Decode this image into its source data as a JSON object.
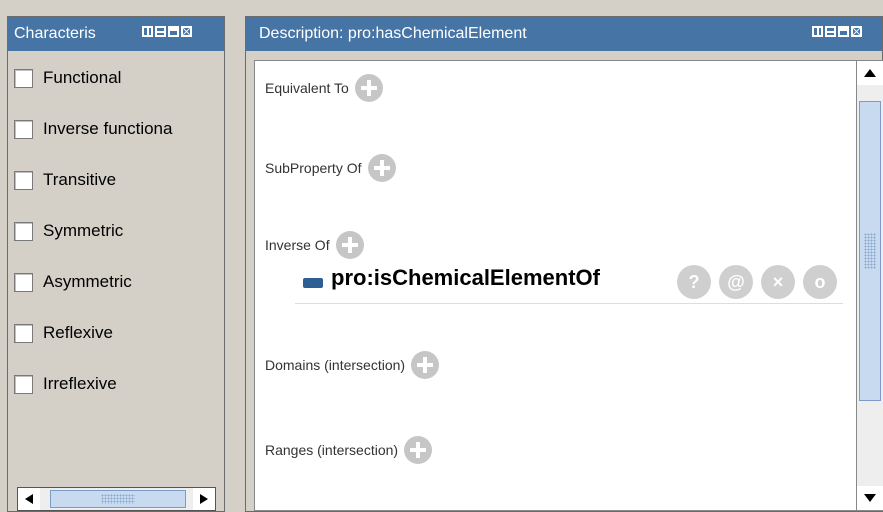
{
  "left_panel": {
    "title": "Characteris",
    "checkboxes": [
      {
        "label": "Functional",
        "checked": false
      },
      {
        "label": "Inverse functiona",
        "checked": false
      },
      {
        "label": "Transitive",
        "checked": false
      },
      {
        "label": "Symmetric",
        "checked": false
      },
      {
        "label": "Asymmetric",
        "checked": false
      },
      {
        "label": "Reflexive",
        "checked": false
      },
      {
        "label": "Irreflexive",
        "checked": false
      }
    ]
  },
  "right_panel": {
    "title": "Description: pro:hasChemicalElement",
    "sections": {
      "equivalent_to": "Equivalent To",
      "subproperty_of": "SubProperty Of",
      "inverse_of": "Inverse Of",
      "domains": "Domains (intersection)",
      "ranges": "Ranges (intersection)"
    },
    "inverse_item": {
      "name": "pro:isChemicalElementOf",
      "swatch_color": "#2d5f95",
      "buttons": [
        "?",
        "@",
        "×",
        "o"
      ]
    }
  },
  "colors": {
    "titlebar": "#4674a4",
    "panel_bg": "#d4d0c8",
    "scroll_thumb": "#c7daf0",
    "plus_button": "#c6c6c6"
  }
}
